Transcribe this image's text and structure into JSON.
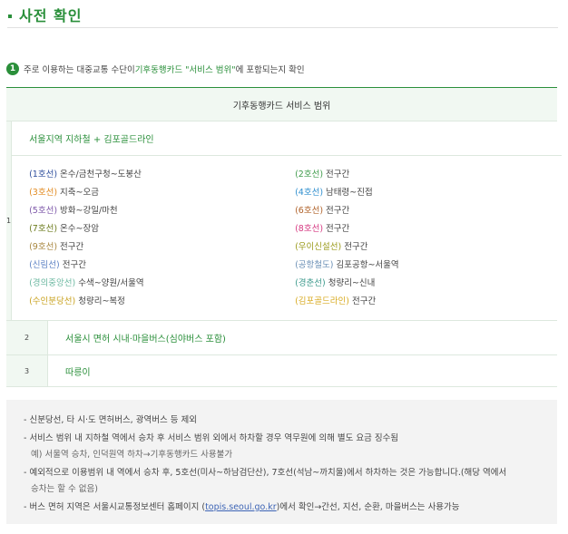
{
  "section": {
    "title": "사전 확인"
  },
  "question": {
    "number": "1",
    "prefix": "주로 이용하는 대중교통 수단이 ",
    "highlight": "기후동행카드 \"서비스 범위\"",
    "suffix": "에 포함되는지 확인"
  },
  "table": {
    "header": "기후동행카드 서비스 범위",
    "rows": [
      {
        "index": "1",
        "title": "서울지역 지하철 + 김포골드라인",
        "left": [
          {
            "line": "(1호선)",
            "color": "#2d4d9c",
            "desc": " 온수/금천구청~도봉산"
          },
          {
            "line": "(3호선)",
            "color": "#e28a1f",
            "desc": " 지축~오금"
          },
          {
            "line": "(5호선)",
            "color": "#7c56a8",
            "desc": " 방화~강일/마천"
          },
          {
            "line": "(7호선)",
            "color": "#6d7c1f",
            "desc": " 온수~장암"
          },
          {
            "line": "(9호선)",
            "color": "#a8873f",
            "desc": " 전구간"
          },
          {
            "line": "(신림선)",
            "color": "#5d82c4",
            "desc": " 전구간"
          },
          {
            "line": "(경의중앙선)",
            "color": "#6cb8a1",
            "desc": " 수색~양원/서울역"
          },
          {
            "line": "(수인분당선)",
            "color": "#c9a21f",
            "desc": " 청량리~복정"
          }
        ],
        "right": [
          {
            "line": "(2호선)",
            "color": "#3f9b4b",
            "desc": " 전구간"
          },
          {
            "line": "(4호선)",
            "color": "#2f8fcf",
            "desc": " 남태령~진접"
          },
          {
            "line": "(6호선)",
            "color": "#b0622a",
            "desc": " 전구간"
          },
          {
            "line": "(8호선)",
            "color": "#d63a82",
            "desc": " 전구간"
          },
          {
            "line": "(우이신설선)",
            "color": "#9a9a1a",
            "desc": " 전구간"
          },
          {
            "line": "(공항철도)",
            "color": "#6a8fb5",
            "desc": " 김포공항~서울역"
          },
          {
            "line": "(경춘선)",
            "color": "#3d9a8c",
            "desc": " 청량리~신내"
          },
          {
            "line": "(김포골드라인)",
            "color": "#d8aa1f",
            "desc": " 전구간"
          }
        ]
      },
      {
        "index": "2",
        "title": "서울시 면허 시내·마을버스(심야버스 포함)"
      },
      {
        "index": "3",
        "title": "따릉이"
      }
    ]
  },
  "notes": {
    "n1": "- 신분당선, 타 시·도 면허버스, 광역버스 등 제외",
    "n2": "- 서비스 범위 내 지하철 역에서 승차 후 서비스 범위 외에서 하차할 경우 역무원에 의해 별도 요금 징수됨",
    "n2_example": "예) 서울역 승차, 인덕원역 하차→기후동행카드 사용불가",
    "n3": "- 예외적으로 이용범위 내 역에서 승차 후, 5호선(미사~하남검단산), 7호선(석남~까치울)에서 하차하는 것은 가능합니다.(해당 역에서",
    "n3_cont": "승차는 할 수 없음)",
    "n4_prefix": "- 버스 면허 지역은 서울시교통정보센터 홈페이지 (",
    "n4_link": "topis.seoul.go.kr",
    "n4_suffix": ")에서 확인→간선, 지선, 순환, 마을버스는 사용가능"
  }
}
